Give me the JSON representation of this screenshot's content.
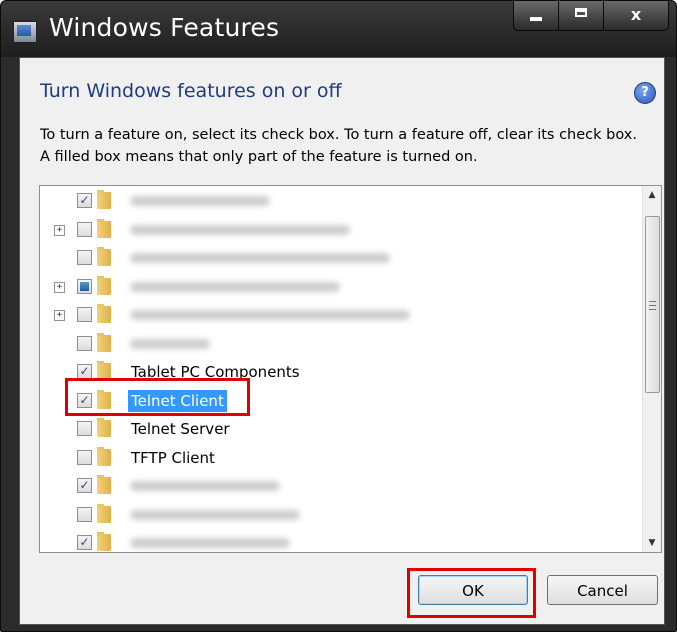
{
  "window": {
    "title": "Windows Features",
    "minimize_icon": "minimize-icon",
    "maximize_icon": "maximize-icon",
    "close_label": "x"
  },
  "header": {
    "heading": "Turn Windows features on or off",
    "help_label": "?",
    "description": "To turn a feature on, select its check box. To turn a feature off, clear its check box. A filled box means that only part of the feature is turned on."
  },
  "features": [
    {
      "label": "",
      "checked": true,
      "expandable": false,
      "blurred": true
    },
    {
      "label": "",
      "checked": false,
      "expandable": true,
      "blurred": true
    },
    {
      "label": "",
      "checked": false,
      "expandable": false,
      "blurred": true
    },
    {
      "label": "",
      "checked": "partial",
      "expandable": true,
      "blurred": true
    },
    {
      "label": "",
      "checked": false,
      "expandable": true,
      "blurred": true
    },
    {
      "label": "",
      "checked": false,
      "expandable": false,
      "blurred": true
    },
    {
      "label": "Tablet PC Components",
      "checked": true,
      "expandable": false,
      "blurred": false
    },
    {
      "label": "Telnet Client",
      "checked": true,
      "expandable": false,
      "blurred": false,
      "selected": true
    },
    {
      "label": "Telnet Server",
      "checked": false,
      "expandable": false,
      "blurred": false
    },
    {
      "label": "TFTP Client",
      "checked": false,
      "expandable": false,
      "blurred": false
    },
    {
      "label": "",
      "checked": true,
      "expandable": false,
      "blurred": true
    },
    {
      "label": "",
      "checked": false,
      "expandable": false,
      "blurred": true
    },
    {
      "label": "",
      "checked": true,
      "expandable": false,
      "blurred": true
    }
  ],
  "buttons": {
    "ok": "OK",
    "cancel": "Cancel"
  },
  "colors": {
    "heading": "#1e3b87",
    "selection": "#3399ff",
    "highlight_box": "#e00000"
  }
}
